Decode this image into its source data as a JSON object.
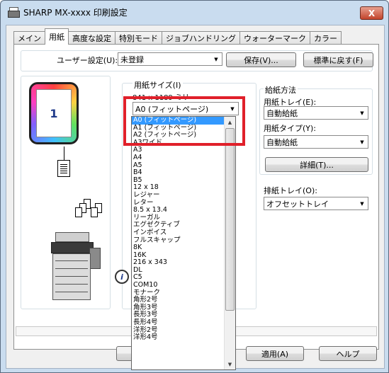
{
  "window": {
    "title": "SHARP MX-xxxx 印刷設定",
    "close": "X"
  },
  "tabs": [
    "メイン",
    "用紙",
    "高度な設定",
    "特別モード",
    "ジョブハンドリング",
    "ウォーターマーク",
    "カラー"
  ],
  "user_settings": {
    "label": "ユーザー設定(U):",
    "value": "未登録",
    "save": "保存(V)...",
    "reset": "標準に戻す(F)"
  },
  "paper_size": {
    "label": "用紙サイズ(I)",
    "dims": "841 x 1189 ミリ",
    "value": "A0 (フィットページ)"
  },
  "preview": {
    "page_number": "1"
  },
  "dropdown_items": [
    "A0 (フィットページ)",
    "A1 (フィットページ)",
    "A2 (フィットページ)",
    "A3ワイド",
    "A3",
    "A4",
    "A5",
    "B4",
    "B5",
    "12 x 18",
    "レジャー",
    "レター",
    "8.5 x 13.4",
    "リーガル",
    "エグゼクティブ",
    "インボイス",
    "フルスキャップ",
    "8K",
    "16K",
    "216 x 343",
    "DL",
    "C5",
    "COM10",
    "モナーク",
    "角形2号",
    "角形3号",
    "長形3号",
    "長形4号",
    "洋形2号",
    "洋形4号"
  ],
  "feed": {
    "group": "給紙方法",
    "tray_label": "用紙トレイ(E):",
    "tray_value": "自動給紙",
    "type_label": "用紙タイプ(Y):",
    "type_value": "自動給紙",
    "detail": "詳細(T)..."
  },
  "output": {
    "label": "排紙トレイ(O):",
    "value": "オフセットトレイ"
  },
  "footer": {
    "apply": "適用(A)",
    "help": "ヘルプ"
  },
  "colors": {
    "highlight": "#e0202a",
    "selection": "#3399ff"
  }
}
